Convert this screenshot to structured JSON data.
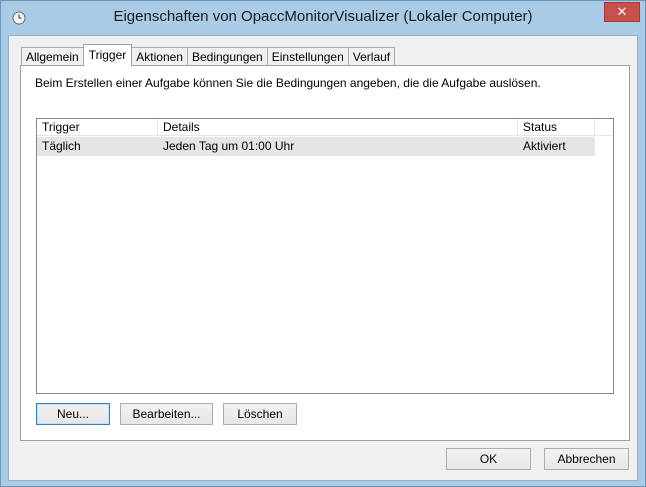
{
  "window": {
    "title": "Eigenschaften von OpaccMonitorVisualizer (Lokaler Computer)",
    "close_symbol": "✕"
  },
  "tabs": [
    {
      "label": "Allgemein",
      "active": false
    },
    {
      "label": "Trigger",
      "active": true
    },
    {
      "label": "Aktionen",
      "active": false
    },
    {
      "label": "Bedingungen",
      "active": false
    },
    {
      "label": "Einstellungen",
      "active": false
    },
    {
      "label": "Verlauf",
      "active": false
    }
  ],
  "trigger_tab": {
    "description": "Beim Erstellen einer Aufgabe können Sie die Bedingungen angeben, die die Aufgabe auslösen.",
    "columns": {
      "trigger": "Trigger",
      "details": "Details",
      "status": "Status"
    },
    "rows": [
      {
        "trigger": "Täglich",
        "details": "Jeden Tag um 01:00 Uhr",
        "status": "Aktiviert"
      }
    ],
    "buttons": {
      "new": "Neu...",
      "edit": "Bearbeiten...",
      "delete": "Löschen"
    }
  },
  "dialog_buttons": {
    "ok": "OK",
    "cancel": "Abbrechen"
  },
  "colors": {
    "titlebar": "#a9cbe6",
    "close_button": "#c7504b",
    "selected_row": "#e5e5e5"
  }
}
